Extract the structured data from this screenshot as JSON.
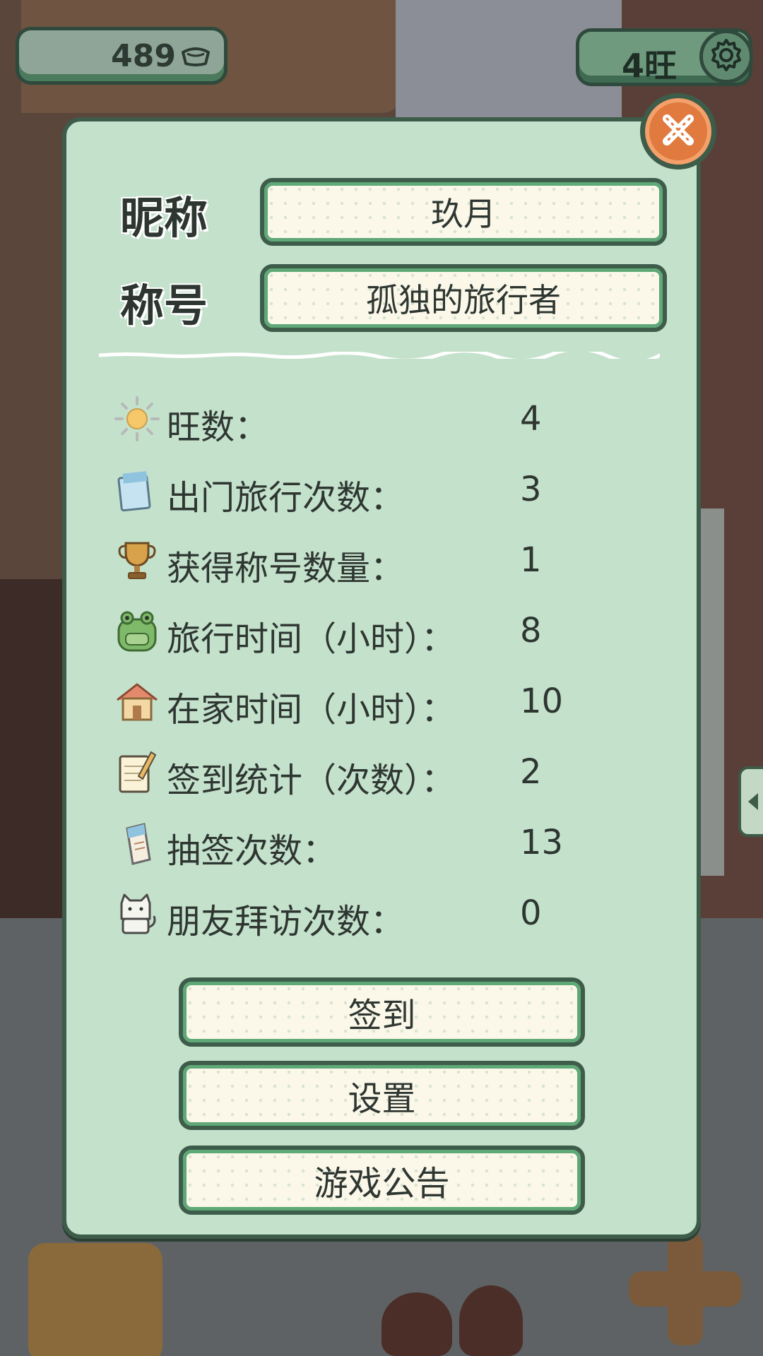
{
  "hud": {
    "coins": "489",
    "coin_icon": "ingot-icon",
    "wang": "4旺",
    "settings_icon": "gear-icon"
  },
  "profile": {
    "nickname_label": "昵称",
    "nickname_value": "玖月",
    "title_label": "称号",
    "title_value": "孤独的旅行者"
  },
  "stats": [
    {
      "icon": "sun-icon",
      "label": "旺数：",
      "value": "4"
    },
    {
      "icon": "postcard-icon",
      "label": "出门旅行次数：",
      "value": "3"
    },
    {
      "icon": "trophy-icon",
      "label": "获得称号数量：",
      "value": "1"
    },
    {
      "icon": "frog-backpack-icon",
      "label": "旅行时间（小时）：",
      "value": "8"
    },
    {
      "icon": "house-icon",
      "label": "在家时间（小时）：",
      "value": "10"
    },
    {
      "icon": "notepad-pencil-icon",
      "label": "签到统计（次数）：",
      "value": "2"
    },
    {
      "icon": "fortune-slip-icon",
      "label": "抽签次数：",
      "value": "13"
    },
    {
      "icon": "cat-icon",
      "label": "朋友拜访次数：",
      "value": "0"
    }
  ],
  "buttons": {
    "checkin": "签到",
    "settings": "设置",
    "announcement": "游戏公告"
  },
  "colors": {
    "panel_bg": "#c4e1cc",
    "panel_border": "#3d5c49",
    "button_accent": "#5fa877",
    "close_button": "#e07a3e"
  }
}
